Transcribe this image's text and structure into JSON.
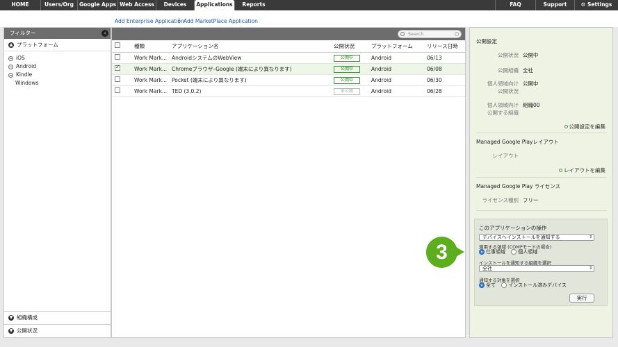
{
  "topnav": {
    "items": [
      "HOME",
      "Users/Org",
      "Google Apps",
      "Web Access",
      "Devices",
      "Applications",
      "Reports"
    ],
    "active": "Applications",
    "right": [
      "FAQ",
      "Support",
      "Settings"
    ]
  },
  "sublinks": {
    "add_enterprise": "Add Enterprise Application",
    "separator": "|",
    "add_marketplace": "Add MarketPlace Application"
  },
  "filter": {
    "title": "フィルター",
    "platform_section": "プラットフォーム",
    "platforms": [
      "iOS",
      "Android",
      "Kindle",
      "Windows"
    ],
    "org_section": "組織構成",
    "status_section": "公開状況"
  },
  "table": {
    "search_placeholder": "Search",
    "headers": [
      "",
      "種類",
      "アプリケーション名",
      "公開状況",
      "プラットフォーム",
      "リリース日時"
    ],
    "rows": [
      {
        "type": "Work Mark...",
        "name": "AndroidシステムのWebView",
        "status": "公開中",
        "platform": "Android",
        "date": "06/13",
        "checked": false
      },
      {
        "type": "Work Mark...",
        "name": "Chromeブラウザ–Google (端末により異なります)",
        "status": "公開中",
        "platform": "Android",
        "date": "06/08",
        "checked": true
      },
      {
        "type": "Work Mark...",
        "name": "Pocket (端末により異なります)",
        "status": "公開中",
        "platform": "Android",
        "date": "06/30",
        "checked": false
      },
      {
        "type": "Work Mark...",
        "name": "TED (3.0.2)",
        "status": "非公開",
        "platform": "Android",
        "date": "06/28",
        "checked": false
      }
    ]
  },
  "details": {
    "publish_title": "公開設定",
    "status_label": "公開状況",
    "status_value": "公開中",
    "org_label": "公開組織",
    "org_value": "全社",
    "personal_status_label": "個人領域向け\n公開状況",
    "personal_status_value": "公開中",
    "personal_org_label": "個人領域向け\n公開する組織",
    "personal_org_value": "組織00",
    "edit_publish_link": "公開設定を編集",
    "layout_title": "Managed Google Playレイアウト",
    "layout_label": "レイアウト",
    "edit_layout_link": "レイアウトを編集",
    "license_title": "Managed Google Play ライセンス",
    "license_label": "ライセンス種別",
    "license_value": "フリー"
  },
  "operations": {
    "title": "このアプリケーションの操作",
    "action_select": "デバイスへインストールを通知する",
    "scope_label": "適用する領域 (COMPモードの場合)",
    "scope_work": "仕事領域",
    "scope_personal": "個人領域",
    "org_label": "インストールを通知する組織を選択",
    "org_select": "全社",
    "target_label": "通知する対象を選択",
    "target_all": "全て",
    "target_installed": "インストール済みデバイス",
    "execute": "実行"
  },
  "callout": {
    "number": "3",
    "color": "#5cae1e"
  }
}
